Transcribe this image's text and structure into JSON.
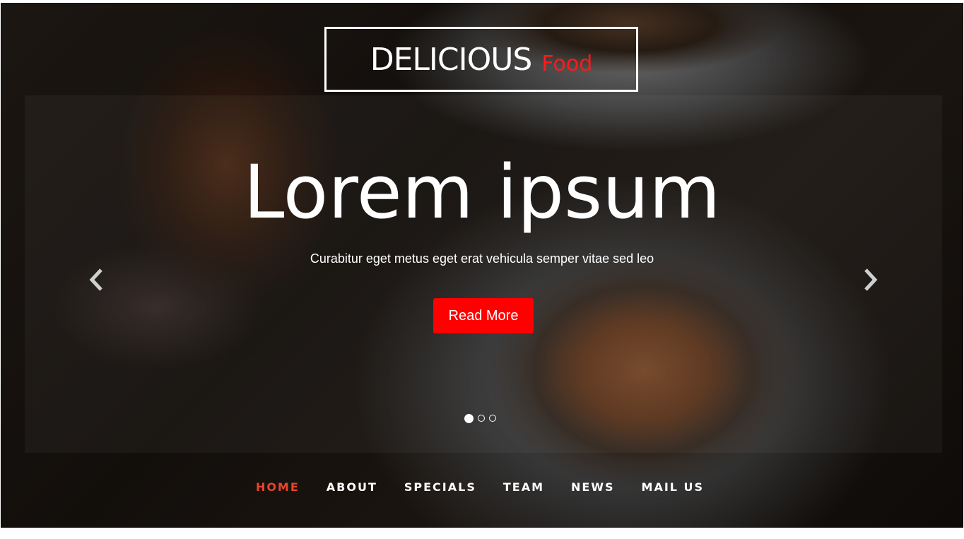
{
  "logo": {
    "main": "DELICIOUS",
    "accent": "Food"
  },
  "carousel": {
    "headline": "Lorem ipsum",
    "subheadline": "Curabitur eget metus eget erat vehicula semper vitae sed leo",
    "cta_label": "Read More",
    "prev_icon": "chevron-left-icon",
    "next_icon": "chevron-right-icon",
    "slide_count": 3,
    "active_slide": 1
  },
  "nav": {
    "items": [
      {
        "label": "HOME",
        "active": true
      },
      {
        "label": "ABOUT",
        "active": false
      },
      {
        "label": "SPECIALS",
        "active": false
      },
      {
        "label": "TEAM",
        "active": false
      },
      {
        "label": "NEWS",
        "active": false
      },
      {
        "label": "MAIL US",
        "active": false
      }
    ]
  },
  "colors": {
    "accent_red": "#ff0000",
    "nav_active": "#e8452a",
    "text": "#ffffff"
  }
}
